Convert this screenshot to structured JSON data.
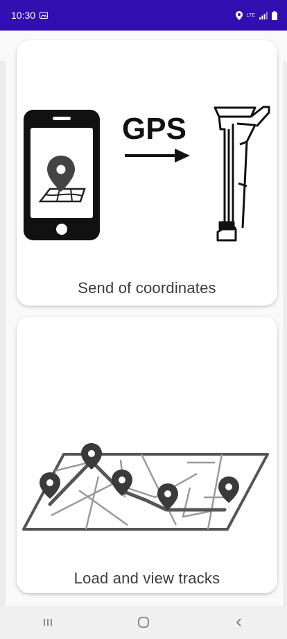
{
  "status_bar": {
    "time": "10:30",
    "notification_icon": "gallery-icon",
    "location_icon": "location-pin-icon",
    "network_text": "LTE",
    "signal_icon": "signal-bars-icon",
    "battery_icon": "battery-icon",
    "background_color": "#2f0fb0"
  },
  "cards": {
    "send": {
      "label": "Send of coordinates",
      "gps_text": "GPS",
      "icons": [
        "smartphone-icon",
        "map-pin-icon",
        "arrow-right-icon",
        "cable-locator-icon"
      ]
    },
    "tracks": {
      "label": "Load and view tracks",
      "icons": [
        "map-with-route-icon",
        "map-pin-icon"
      ]
    }
  },
  "nav_bar": {
    "recent_icon": "recent-apps-icon",
    "home_icon": "home-icon",
    "back_icon": "back-icon"
  }
}
